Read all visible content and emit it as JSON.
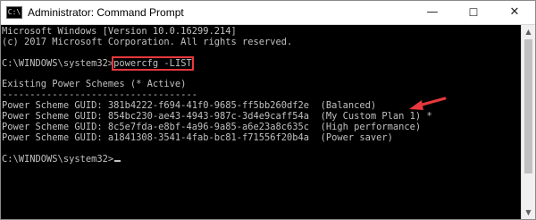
{
  "window": {
    "title": "Administrator: Command Prompt",
    "icon_label": "C:\\",
    "minimize_glyph": "—",
    "maximize_glyph": "☐",
    "close_glyph": "✕"
  },
  "console": {
    "header_line_1": "Microsoft Windows [Version 10.0.16299.214]",
    "header_line_2": "(c) 2017 Microsoft Corporation. All rights reserved.",
    "prompt": "C:\\WINDOWS\\system32>",
    "command": "powercfg -LIST",
    "section_title": "Existing Power Schemes (* Active)",
    "separator": "-----------------------------------",
    "schemes": [
      {
        "label": "Power Scheme GUID: ",
        "guid": "381b4222-f694-41f0-9685-ff5bb260df2e",
        "name": "  (Balanced)"
      },
      {
        "label": "Power Scheme GUID: ",
        "guid": "854bc230-ae43-4943-987c-3d4e9caff54a",
        "name": "  (My Custom Plan 1) *"
      },
      {
        "label": "Power Scheme GUID: ",
        "guid": "8c5e7fda-e8bf-4a96-9a85-a6e23a8c635c",
        "name": "  (High performance)"
      },
      {
        "label": "Power Scheme GUID: ",
        "guid": "a1841308-3541-4fab-bc81-f71556f20b4a",
        "name": "  (Power saver)"
      }
    ],
    "final_prompt": "C:\\WINDOWS\\system32>"
  },
  "scrollbar": {
    "up_glyph": "▲",
    "down_glyph": "▼"
  },
  "colors": {
    "console_bg": "#000000",
    "console_text": "#c0c0c0",
    "highlight_red": "#e8383d"
  },
  "icons": {
    "annotation": "red-arrow-icon"
  }
}
